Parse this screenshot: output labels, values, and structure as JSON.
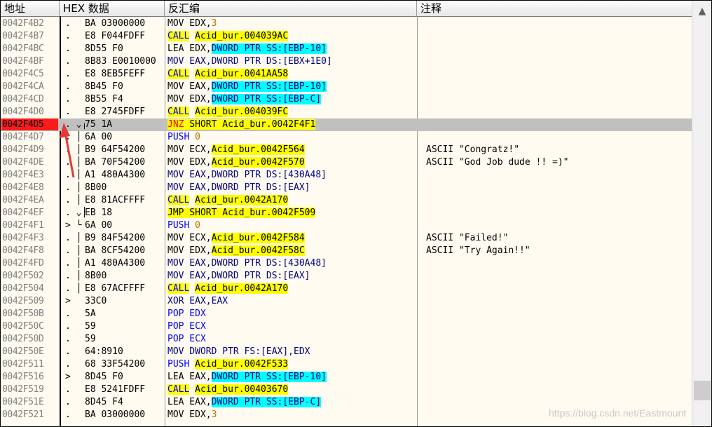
{
  "headers": {
    "address": "地址",
    "hex": "HEX 数据",
    "disasm": "反汇编",
    "comment": "注释"
  },
  "scrollbar": {
    "up_icon": "▲"
  },
  "watermark": "https://blog.csdn.net/Eastmount",
  "selected_row_index": 9,
  "rows": [
    {
      "addr": "0042F4B2",
      "mark": ".",
      "hex": "BA 03000000",
      "dis": [
        {
          "t": "MOV EDX,"
        },
        {
          "t": "3",
          "c": "orange"
        }
      ],
      "cmt": ""
    },
    {
      "addr": "0042F4B7",
      "mark": ".",
      "hex": "E8 F044FDFF",
      "dis": [
        {
          "t": "CALL",
          "c": "y blue"
        },
        {
          "t": " "
        },
        {
          "t": "Acid_bur.004039AC",
          "c": "y"
        }
      ],
      "cmt": ""
    },
    {
      "addr": "0042F4BC",
      "mark": ".",
      "hex": "8D55 F0",
      "dis": [
        {
          "t": "LEA EDX,"
        },
        {
          "t": "DWORD PTR SS:[EBP-10]",
          "c": "cy"
        }
      ],
      "cmt": ""
    },
    {
      "addr": "0042F4BF",
      "mark": ".",
      "hex": "8B83 E0010000",
      "dis": [
        {
          "t": "MOV EAX,DWORD PTR DS:[EBX+1E0]",
          "c": "navy"
        }
      ],
      "cmt": ""
    },
    {
      "addr": "0042F4C5",
      "mark": ".",
      "hex": "E8 8EB5FEFF",
      "dis": [
        {
          "t": "CALL",
          "c": "y blue"
        },
        {
          "t": " "
        },
        {
          "t": "Acid_bur.0041AA58",
          "c": "y"
        }
      ],
      "cmt": ""
    },
    {
      "addr": "0042F4CA",
      "mark": ".",
      "hex": "8B45 F0",
      "dis": [
        {
          "t": "MOV EAX,"
        },
        {
          "t": "DWORD PTR SS:[EBP-10]",
          "c": "cy"
        }
      ],
      "cmt": ""
    },
    {
      "addr": "0042F4CD",
      "mark": ".",
      "hex": "8B55 F4",
      "dis": [
        {
          "t": "MOV EDX,"
        },
        {
          "t": "DWORD PTR SS:[EBP-C]",
          "c": "cy"
        }
      ],
      "cmt": ""
    },
    {
      "addr": "0042F4D0",
      "mark": ".",
      "hex": "E8 2745FDFF",
      "dis": [
        {
          "t": "CALL",
          "c": "y blue"
        },
        {
          "t": " "
        },
        {
          "t": "Acid_bur.004039FC",
          "c": "y"
        }
      ],
      "cmt": ""
    },
    {
      "addr": "0042F4D5",
      "mark": ". ⌄┌",
      "hex": "75 1A",
      "dis": [
        {
          "t": "JNZ",
          "c": "y-red"
        },
        {
          "t": " SHORT Acid_bur.0042F4F1",
          "c": "y"
        }
      ],
      "cmt": ""
    },
    {
      "addr": "0042F4D7",
      "mark": ". │",
      "hex": "6A 00",
      "dis": [
        {
          "t": "PUSH ",
          "c": "blue"
        },
        {
          "t": "0",
          "c": "orange"
        }
      ],
      "cmt": ""
    },
    {
      "addr": "0042F4D9",
      "mark": ". │",
      "hex": "B9 64F54200",
      "dis": [
        {
          "t": "MOV ECX,"
        },
        {
          "t": "Acid_bur.0042F564",
          "c": "y"
        }
      ],
      "cmt": "ASCII \"Congratz!\""
    },
    {
      "addr": "0042F4DE",
      "mark": ". │",
      "hex": "BA 70F54200",
      "dis": [
        {
          "t": "MOV EDX,"
        },
        {
          "t": "Acid_bur.0042F570",
          "c": "y"
        }
      ],
      "cmt": "ASCII \"God Job dude !! =)\""
    },
    {
      "addr": "0042F4E3",
      "mark": ". │",
      "hex": "A1 480A4300",
      "dis": [
        {
          "t": "MOV EAX,DWORD PTR DS:[430A48]",
          "c": "navy"
        }
      ],
      "cmt": ""
    },
    {
      "addr": "0042F4E8",
      "mark": ". │",
      "hex": "8B00",
      "dis": [
        {
          "t": "MOV EAX,DWORD PTR DS:[EAX]",
          "c": "navy"
        }
      ],
      "cmt": ""
    },
    {
      "addr": "0042F4EA",
      "mark": ". │",
      "hex": "E8 81ACFFFF",
      "dis": [
        {
          "t": "CALL",
          "c": "y blue"
        },
        {
          "t": " "
        },
        {
          "t": "Acid_bur.0042A170",
          "c": "y"
        }
      ],
      "cmt": ""
    },
    {
      "addr": "0042F4EF",
      "mark": ". ⌄│",
      "hex": "EB 18",
      "dis": [
        {
          "t": "JMP SHORT Acid_bur.0042F509",
          "c": "y"
        }
      ],
      "cmt": ""
    },
    {
      "addr": "0042F4F1",
      "mark": "> └",
      "hex": "6A 00",
      "dis": [
        {
          "t": "PUSH ",
          "c": "blue"
        },
        {
          "t": "0",
          "c": "orange"
        }
      ],
      "cmt": ""
    },
    {
      "addr": "0042F4F3",
      "mark": ". │",
      "hex": "B9 84F54200",
      "dis": [
        {
          "t": "MOV ECX,"
        },
        {
          "t": "Acid_bur.0042F584",
          "c": "y"
        }
      ],
      "cmt": "ASCII \"Failed!\""
    },
    {
      "addr": "0042F4F8",
      "mark": ". │",
      "hex": "BA 8CF54200",
      "dis": [
        {
          "t": "MOV EDX,"
        },
        {
          "t": "Acid_bur.0042F58C",
          "c": "y"
        }
      ],
      "cmt": "ASCII \"Try Again!!\""
    },
    {
      "addr": "0042F4FD",
      "mark": ". │",
      "hex": "A1 480A4300",
      "dis": [
        {
          "t": "MOV EAX,DWORD PTR DS:[430A48]",
          "c": "navy"
        }
      ],
      "cmt": ""
    },
    {
      "addr": "0042F502",
      "mark": ". │",
      "hex": "8B00",
      "dis": [
        {
          "t": "MOV EAX,DWORD PTR DS:[EAX]",
          "c": "navy"
        }
      ],
      "cmt": ""
    },
    {
      "addr": "0042F504",
      "mark": ". │",
      "hex": "E8 67ACFFFF",
      "dis": [
        {
          "t": "CALL",
          "c": "y blue"
        },
        {
          "t": " "
        },
        {
          "t": "Acid_bur.0042A170",
          "c": "y"
        }
      ],
      "cmt": ""
    },
    {
      "addr": "0042F509",
      "mark": "> ",
      "hex": "33C0",
      "dis": [
        {
          "t": "XOR EAX,EAX",
          "c": "navy"
        }
      ],
      "cmt": ""
    },
    {
      "addr": "0042F50B",
      "mark": ". ",
      "hex": "5A",
      "dis": [
        {
          "t": "POP EDX",
          "c": "blue"
        }
      ],
      "cmt": ""
    },
    {
      "addr": "0042F50C",
      "mark": ". ",
      "hex": "59",
      "dis": [
        {
          "t": "POP ECX",
          "c": "blue"
        }
      ],
      "cmt": ""
    },
    {
      "addr": "0042F50D",
      "mark": ". ",
      "hex": "59",
      "dis": [
        {
          "t": "POP ECX",
          "c": "blue"
        }
      ],
      "cmt": ""
    },
    {
      "addr": "0042F50E",
      "mark": ". ",
      "hex": "64:8910",
      "dis": [
        {
          "t": "MOV DWORD PTR FS:[EAX],EDX",
          "c": "navy"
        }
      ],
      "cmt": ""
    },
    {
      "addr": "0042F511",
      "mark": ". ",
      "hex": "68 33F54200",
      "dis": [
        {
          "t": "PUSH ",
          "c": "blue"
        },
        {
          "t": "Acid_bur.0042F533",
          "c": "y"
        }
      ],
      "cmt": ""
    },
    {
      "addr": "0042F516",
      "mark": "> ",
      "hex": "8D45 F0",
      "dis": [
        {
          "t": "LEA EAX,"
        },
        {
          "t": "DWORD PTR SS:[EBP-10]",
          "c": "cy"
        }
      ],
      "cmt": ""
    },
    {
      "addr": "0042F519",
      "mark": ". ",
      "hex": "E8 5241FDFF",
      "dis": [
        {
          "t": "CALL",
          "c": "y blue"
        },
        {
          "t": " "
        },
        {
          "t": "Acid_bur.00403670",
          "c": "y"
        }
      ],
      "cmt": ""
    },
    {
      "addr": "0042F51E",
      "mark": ". ",
      "hex": "8D45 F4",
      "dis": [
        {
          "t": "LEA EAX,"
        },
        {
          "t": "DWORD PTR SS:[EBP-C]",
          "c": "cy"
        }
      ],
      "cmt": ""
    },
    {
      "addr": "0042F521",
      "mark": ". ",
      "hex": "BA 03000000",
      "dis": [
        {
          "t": "MOV EDX,"
        },
        {
          "t": "3",
          "c": "orange"
        }
      ],
      "cmt": ""
    }
  ]
}
